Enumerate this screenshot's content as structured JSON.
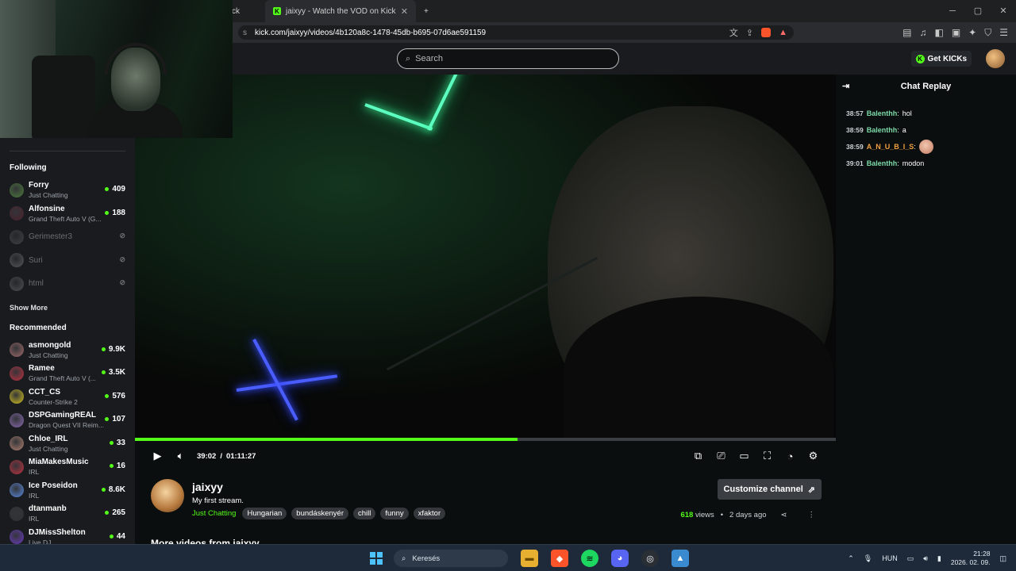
{
  "browser": {
    "tab_prev_label": "ck",
    "tab_active_label": "jaixyy - Watch the VOD on Kick",
    "new_tab_symbol": "+",
    "url_prefix": "s",
    "url_host": "kick.com/jaixyy/videos/4b120a8c-1478-45db-b695-07d6ae591159"
  },
  "header": {
    "search_placeholder": "Search",
    "get_kicks_label": "Get KICKs"
  },
  "sidebar": {
    "following_title": "Following",
    "following": [
      {
        "name": "Forry",
        "category": "Just Chatting",
        "viewers": "409",
        "live": true,
        "color": "#4b7a3a"
      },
      {
        "name": "Alfonsine",
        "category": "Grand Theft Auto V (G...",
        "viewers": "188",
        "live": true,
        "color": "#4a1f2a"
      },
      {
        "name": "Gerimester3",
        "category": "",
        "viewers": "",
        "live": false,
        "color": "#707070"
      },
      {
        "name": "Suri",
        "category": "",
        "viewers": "",
        "live": false,
        "color": "#a0a0a0"
      },
      {
        "name": "html",
        "category": "",
        "viewers": "",
        "live": false,
        "color": "#909090"
      }
    ],
    "show_more": "Show More",
    "recommended_title": "Recommended",
    "recommended": [
      {
        "name": "asmongold",
        "category": "Just Chatting",
        "viewers": "9.9K",
        "color": "#a06a6a"
      },
      {
        "name": "Ramee",
        "category": "Grand Theft Auto V (...",
        "viewers": "3.5K",
        "color": "#c03040"
      },
      {
        "name": "CCT_CS",
        "category": "Counter-Strike 2",
        "viewers": "576",
        "color": "#d4c020"
      },
      {
        "name": "DSPGamingREAL",
        "category": "Dragon Quest VII Reim...",
        "viewers": "107",
        "color": "#8a6ab0"
      },
      {
        "name": "Chloe_IRL",
        "category": "Just Chatting",
        "viewers": "33",
        "color": "#b08070"
      },
      {
        "name": "MiaMakesMusic",
        "category": "IRL",
        "viewers": "16",
        "color": "#c03040"
      },
      {
        "name": "Ice Poseidon",
        "category": "IRL",
        "viewers": "8.6K",
        "color": "#5a8ae0"
      },
      {
        "name": "dtanmanb",
        "category": "IRL",
        "viewers": "265",
        "color": "#303030"
      },
      {
        "name": "DJMissShelton",
        "category": "Live DJ",
        "viewers": "44",
        "color": "#6a3ac0"
      }
    ]
  },
  "player": {
    "current_time": "39:02",
    "separator": "/",
    "duration": "01:11:27",
    "progress_fraction": 0.546
  },
  "channel": {
    "name": "jaixyy",
    "stream_title": "My first stream.",
    "category": "Just Chatting",
    "tags": [
      "Hungarian",
      "bundáskenyér",
      "chill",
      "funny",
      "xfaktor"
    ],
    "customize_label": "Customize channel",
    "views_count": "618",
    "views_label": "views",
    "bullet": "•",
    "age": "2 days ago",
    "more_videos": "More videos from jaixyy"
  },
  "chat": {
    "title": "Chat Replay",
    "messages": [
      {
        "ts": "38:57",
        "user": "Balenthh",
        "text": "hol",
        "color": "#7cd9a8",
        "emote": false
      },
      {
        "ts": "38:59",
        "user": "Balenthh",
        "text": "a",
        "color": "#7cd9a8",
        "emote": false
      },
      {
        "ts": "38:59",
        "user": "A_N_U_B_I_S",
        "text": "",
        "color": "#f0a040",
        "emote": true
      },
      {
        "ts": "39:01",
        "user": "Balenthh",
        "text": "modon",
        "color": "#7cd9a8",
        "emote": false
      }
    ]
  },
  "taskbar": {
    "search_label": "Keresés",
    "language": "HUN",
    "time": "21:28",
    "date": "2026. 02. 09."
  },
  "colors": {
    "accent": "#53fc18",
    "background": "#0b0e0f",
    "sidebar": "#191b1f"
  }
}
